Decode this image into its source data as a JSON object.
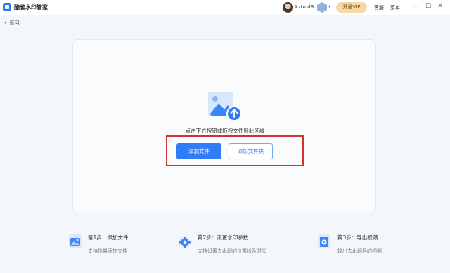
{
  "titlebar": {
    "app_title": "酷雀水印管家",
    "username": "kztmd9",
    "vip_caret": "▾",
    "open_vip": "开通VIP",
    "service": "客服",
    "menu": "菜单",
    "win_controls": [
      "—",
      "☐",
      "✕"
    ]
  },
  "nav": {
    "back_icon": "‹",
    "back_label": "返回"
  },
  "dropzone": {
    "hint": "点击下方按钮或拖拽文件到此区域",
    "add_file": "添加文件",
    "add_folder": "添加文件夹"
  },
  "steps": [
    {
      "title": "第1步：添加文件",
      "desc": "支持批量添加文件",
      "icon": "image-icon"
    },
    {
      "title": "第2步：设置水印参数",
      "desc": "支持设置去水印的位置以及时长",
      "icon": "gear-icon"
    },
    {
      "title": "第3步：导出视频",
      "desc": "输出去水印后的视频",
      "icon": "export-icon"
    }
  ],
  "colors": {
    "primary": "#2f7cf6",
    "highlight": "#d2322d",
    "vip": "#f6d7a7"
  }
}
